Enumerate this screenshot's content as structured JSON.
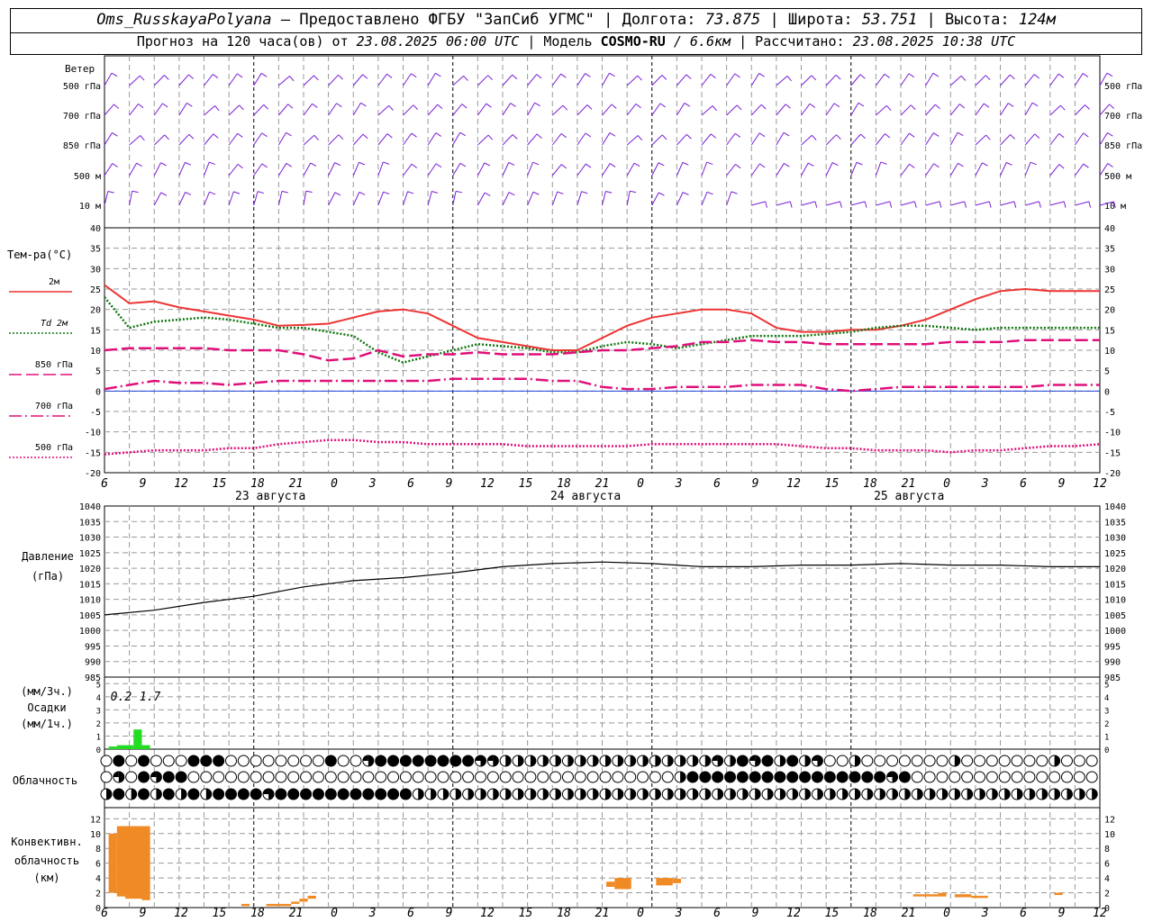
{
  "header": {
    "station": "Oms_RusskayaPolyana",
    "provider": "– Предоставлено ФГБУ \"ЗапСиб УГМС\" |",
    "lon_label": "Долгота:",
    "lon_value": "73.875",
    "lat_label": "| Широта:",
    "lat_value": "53.751",
    "alt_label": "| Высота:",
    "alt_value": "124м",
    "forecast_prefix": "Прогноз на 120 часа(ов) от",
    "forecast_start": "23.08.2025 06:00 UTC",
    "model_prefix": "| Модель",
    "model_name": "COSMO-RU",
    "model_res": "/ 6.6км",
    "calc_prefix": "| Рассчитано:",
    "calc_time": "23.08.2025 10:38 UTC"
  },
  "wind_panel": {
    "title": "Ветер",
    "levels": [
      "500 гПа",
      "700 гПа",
      "850 гПа",
      "500 м",
      "10  м"
    ],
    "color": "#7a1fd6"
  },
  "temp_panel": {
    "title": "Тем-ра(°C)",
    "legend": [
      {
        "label": "2м",
        "color": "#ee3333",
        "style": "solid"
      },
      {
        "label": "Td  2м",
        "color": "#117711",
        "style": "dotted"
      },
      {
        "label": "850 гПа",
        "color": "#e0107a",
        "style": "dashed"
      },
      {
        "label": "700 гПа",
        "color": "#e0107a",
        "style": "dashdot"
      },
      {
        "label": "500 гПа",
        "color": "#e0107a",
        "style": "dotted"
      }
    ]
  },
  "pressure_panel": {
    "title": "Давление",
    "unit": "(гПа)"
  },
  "precip_panel": {
    "label1": "(мм/3ч.)",
    "label2": "Осадки",
    "label3": "(мм/1ч.)",
    "annotations": [
      "0.2",
      "1.7"
    ]
  },
  "cloud_panel": {
    "title": "Облачность"
  },
  "conv_panel": {
    "label1": "Конвективн.",
    "label2": "облачность",
    "label3": "(км)"
  },
  "dates": [
    "23 августа",
    "24 августа",
    "25 августа"
  ],
  "hour_labels": [
    "6",
    "9",
    "12",
    "15",
    "18",
    "21",
    "0",
    "3",
    "6",
    "9",
    "12",
    "15",
    "18",
    "21",
    "0",
    "3",
    "6",
    "9",
    "12",
    "15",
    "18",
    "21",
    "0",
    "3",
    "6",
    "9",
    "12"
  ],
  "chart_data": [
    {
      "type": "line",
      "title": "Тем-ра(°C)",
      "x_hours": [
        0,
        3,
        6,
        9,
        12,
        15,
        18,
        21,
        24,
        27,
        30,
        33,
        36,
        39,
        42,
        45,
        48,
        51,
        54,
        57,
        60,
        63,
        66,
        69,
        72,
        75,
        78,
        81,
        84,
        87,
        90,
        93,
        96,
        99,
        102,
        105,
        108,
        111,
        114,
        117,
        120
      ],
      "x_hours_note": "hours from 23.08.2025 06:00 UTC",
      "ylim": [
        -20,
        40
      ],
      "series": [
        {
          "name": "2м",
          "values": [
            26,
            21.5,
            22,
            20.5,
            19.5,
            18.5,
            17.5,
            16,
            16.2,
            16.5,
            18,
            19.5,
            20,
            19,
            16,
            13,
            12,
            11,
            10,
            10,
            13,
            16,
            18,
            19,
            20,
            20,
            19,
            15.5,
            14.5,
            14.5,
            15,
            15,
            16,
            17.5,
            20,
            22.5,
            24.5,
            25,
            24.5,
            24.5,
            24.5
          ]
        },
        {
          "name": "Td  2м",
          "values": [
            23,
            15.5,
            17,
            17.5,
            18,
            17.5,
            16.5,
            15.5,
            15.5,
            14.5,
            13.5,
            9.5,
            7,
            8.5,
            10,
            11.5,
            11,
            10.5,
            9.5,
            9.5,
            11,
            12,
            11.5,
            10.5,
            11.5,
            12.5,
            13.5,
            13.5,
            13.5,
            14,
            14.5,
            15.5,
            16,
            16,
            15.5,
            15,
            15.5,
            15.5,
            15.5,
            15.5,
            15.5
          ]
        },
        {
          "name": "850 гПа",
          "values": [
            10,
            10.5,
            10.5,
            10.5,
            10.5,
            10,
            10,
            10,
            9,
            7.5,
            8,
            10,
            8.5,
            9,
            9,
            9.5,
            9,
            9,
            9,
            9.5,
            10,
            10,
            10.5,
            11,
            12,
            12,
            12.5,
            12,
            12,
            11.5,
            11.5,
            11.5,
            11.5,
            11.5,
            12,
            12,
            12,
            12.5,
            12.5,
            12.5,
            12.5
          ]
        },
        {
          "name": "700 гПа",
          "values": [
            0.5,
            1.5,
            2.5,
            2,
            2,
            1.5,
            2,
            2.5,
            2.5,
            2.5,
            2.5,
            2.5,
            2.5,
            2.5,
            3,
            3,
            3,
            3,
            2.5,
            2.5,
            1,
            0.5,
            0.5,
            1,
            1,
            1,
            1.5,
            1.5,
            1.5,
            0.5,
            0,
            0.5,
            1,
            1,
            1,
            1,
            1,
            1,
            1.5,
            1.5,
            1.5
          ]
        },
        {
          "name": "500 гПа",
          "values": [
            -15.5,
            -15,
            -14.5,
            -14.5,
            -14.5,
            -14,
            -14,
            -13,
            -12.5,
            -12,
            -12,
            -12.5,
            -12.5,
            -13,
            -13,
            -13,
            -13,
            -13.5,
            -13.5,
            -13.5,
            -13.5,
            -13.5,
            -13,
            -13,
            -13,
            -13,
            -13,
            -13,
            -13.5,
            -14,
            -14,
            -14.5,
            -14.5,
            -14.5,
            -15,
            -14.5,
            -14.5,
            -14,
            -13.5,
            -13.5,
            -13
          ]
        }
      ]
    },
    {
      "type": "line",
      "title": "Давление",
      "ylabel": "(гПа)",
      "ylim": [
        985,
        1040
      ],
      "x_hours": [
        0,
        6,
        12,
        18,
        24,
        30,
        36,
        42,
        48,
        54,
        60,
        66,
        72,
        78,
        84,
        90,
        96,
        102,
        108,
        114,
        120
      ],
      "series": [
        {
          "values": [
            1005,
            1006.5,
            1009,
            1011,
            1014,
            1016,
            1017,
            1018.5,
            1020.5,
            1021.5,
            1022,
            1021.5,
            1020.5,
            1020.5,
            1021,
            1021,
            1021.5,
            1021,
            1021,
            1020.5,
            1020.5
          ]
        }
      ]
    },
    {
      "type": "bar",
      "title": "Осадки",
      "ylabel": "(мм/1ч.)",
      "ylim": [
        0,
        5
      ],
      "x_hours": [
        1,
        2,
        3,
        4,
        5
      ],
      "values": [
        0.2,
        0.3,
        0.3,
        1.5,
        0.3
      ],
      "annotations_mm_3h": [
        0.2,
        1.7
      ]
    },
    {
      "type": "bar",
      "title": "Конвективн. облачность (км)",
      "ylim": [
        0,
        12
      ],
      "bars": [
        {
          "x0": 0.5,
          "x1": 1.5,
          "base": 2,
          "top": 10
        },
        {
          "x0": 1.5,
          "x1": 2.5,
          "base": 1.5,
          "top": 11
        },
        {
          "x0": 2.5,
          "x1": 4.5,
          "base": 1.2,
          "top": 11
        },
        {
          "x0": 4.5,
          "x1": 5.5,
          "base": 1,
          "top": 11
        },
        {
          "x0": 16.5,
          "x1": 17.5,
          "base": 0.2,
          "top": 0.5
        },
        {
          "x0": 19.5,
          "x1": 22.5,
          "base": 0.2,
          "top": 0.5
        },
        {
          "x0": 22.5,
          "x1": 23.5,
          "base": 0.5,
          "top": 0.8
        },
        {
          "x0": 23.5,
          "x1": 24.5,
          "base": 0.8,
          "top": 1.2
        },
        {
          "x0": 24.5,
          "x1": 25.5,
          "base": 1.2,
          "top": 1.6
        },
        {
          "x0": 60.5,
          "x1": 61.5,
          "base": 2.8,
          "top": 3.5
        },
        {
          "x0": 61.5,
          "x1": 63.5,
          "base": 2.5,
          "top": 4
        },
        {
          "x0": 66.5,
          "x1": 68.5,
          "base": 3,
          "top": 4
        },
        {
          "x0": 68.5,
          "x1": 69.5,
          "base": 3.3,
          "top": 3.9
        },
        {
          "x0": 97.5,
          "x1": 100.5,
          "base": 1.5,
          "top": 1.8
        },
        {
          "x0": 100.5,
          "x1": 101.5,
          "base": 1.5,
          "top": 2
        },
        {
          "x0": 102.5,
          "x1": 104.5,
          "base": 1.4,
          "top": 1.8
        },
        {
          "x0": 104.5,
          "x1": 106.5,
          "base": 1.3,
          "top": 1.6
        },
        {
          "x0": 114.5,
          "x1": 115.5,
          "base": 1.7,
          "top": 2
        }
      ]
    },
    {
      "type": "table",
      "title": "Облачность",
      "rows": [
        "OPFPFOOPPPOOOOOOOOPOOQPPPPPPPPQQHHHHHHHHHHHHHHHHHQHPQPHPHQOOHOOOOOOOHOOOOOOOHOOOH",
        "OQOPQPPOOOOOOOOOOOOOOOOOOOOOOOOOOOOOOOOOOOOOOOHPPPPPPPPPPPPPPPPQPOOOOOOOOOOOOOOOO",
        "HPHPHPHPHPPPPQPPPPPPPPPPPHHHHHHHHHHHHHHHHHHHHHHHHHHHHHHHHHHHHHHHHHHHHHHHHHHHHHHHH"
      ],
      "legend": "O=clear, Q=quarter, H=half, P=overcast"
    }
  ]
}
